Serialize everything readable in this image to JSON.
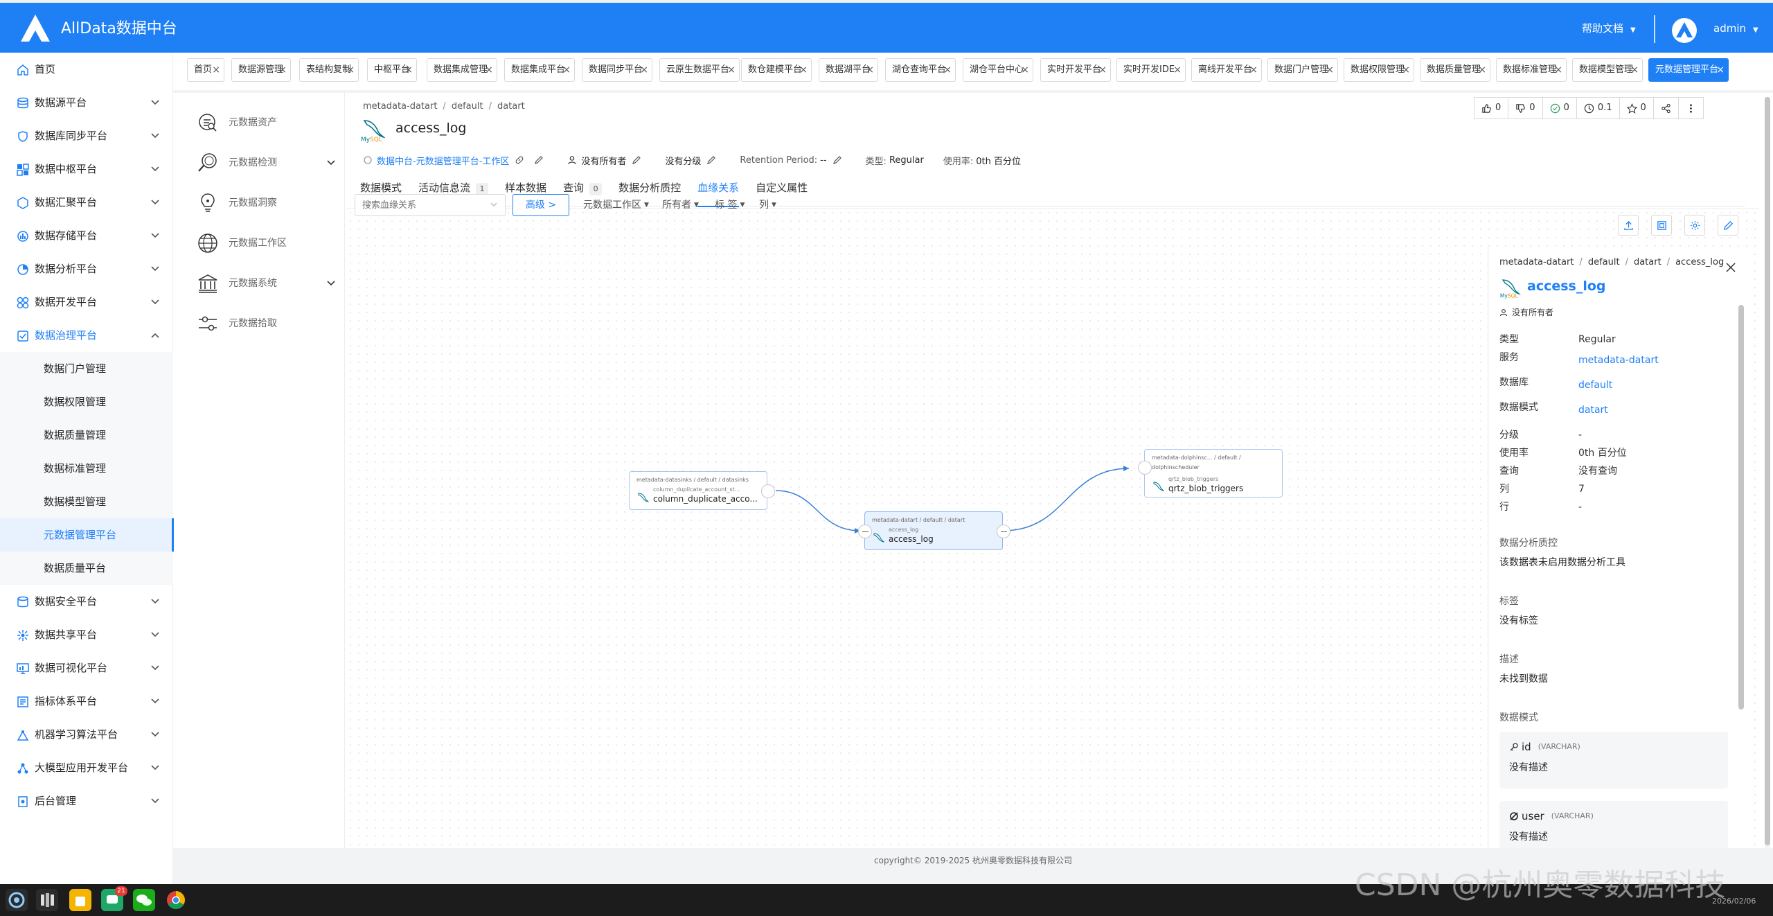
{
  "header": {
    "app_title": "AllData数据中台",
    "help": "帮助文档",
    "user": "admin",
    "brand_color": "#1f80f6"
  },
  "sidebar": {
    "items": [
      {
        "label": "首页",
        "icon": "home-icon"
      },
      {
        "label": "数据源平台",
        "icon": "database-icon"
      },
      {
        "label": "数据库同步平台",
        "icon": "sync-icon"
      },
      {
        "label": "数据中枢平台",
        "icon": "hub-icon"
      },
      {
        "label": "数据汇聚平台",
        "icon": "collect-icon"
      },
      {
        "label": "数据存储平台",
        "icon": "storage-icon"
      },
      {
        "label": "数据分析平台",
        "icon": "analysis-icon"
      },
      {
        "label": "数据开发平台",
        "icon": "develop-icon"
      },
      {
        "label": "数据治理平台",
        "icon": "governance-icon"
      }
    ],
    "sub_items": [
      {
        "label": "数据门户管理"
      },
      {
        "label": "数据权限管理"
      },
      {
        "label": "数据质量管理"
      },
      {
        "label": "数据标准管理"
      },
      {
        "label": "数据模型管理"
      },
      {
        "label": "元数据管理平台"
      },
      {
        "label": "数据质量平台"
      }
    ],
    "bottom_items": [
      {
        "label": "数据安全平台",
        "icon": "security-icon"
      },
      {
        "label": "数据共享平台",
        "icon": "share-icon"
      },
      {
        "label": "数据可视化平台",
        "icon": "visual-icon"
      },
      {
        "label": "指标体系平台",
        "icon": "metric-icon"
      },
      {
        "label": "机器学习算法平台",
        "icon": "ml-icon"
      },
      {
        "label": "大模型应用开发平台",
        "icon": "llm-icon"
      },
      {
        "label": "后台管理",
        "icon": "admin-icon"
      }
    ]
  },
  "tabs": [
    "首页",
    "数据源管理",
    "表结构复制",
    "中枢平台",
    "数据集成管理",
    "数据集成平台",
    "数据同步平台",
    "云原生数据平台",
    "数仓建模平台",
    "数据湖平台",
    "湖仓查询平台",
    "湖仓平台中心",
    "实时开发平台",
    "实时开发IDE",
    "离线开发平台",
    "数据门户管理",
    "数据权限管理",
    "数据质量管理",
    "数据标准管理",
    "数据模型管理",
    "元数据管理平台"
  ],
  "meta_nav": [
    {
      "label": "元数据资产",
      "icon": "asset-search-icon"
    },
    {
      "label": "元数据检测",
      "icon": "magnifier-icon"
    },
    {
      "label": "元数据洞察",
      "icon": "bulb-icon"
    },
    {
      "label": "元数据工作区",
      "icon": "globe-icon"
    },
    {
      "label": "元数据系统",
      "icon": "bank-icon"
    },
    {
      "label": "元数据拾取",
      "icon": "slider-icon"
    }
  ],
  "entity": {
    "breadcrumb": [
      "metadata-datart",
      "default",
      "datart"
    ],
    "name": "access_log",
    "workspace": "数据中台-元数据管理平台-工作区",
    "owner": "没有所有者",
    "tier": "没有分级",
    "retention_label": "Retention Period:",
    "retention_value": "--",
    "type_label": "类型:",
    "type_value": "Regular",
    "usage_label": "使用率:",
    "usage_value": "0th 百分位"
  },
  "actions": {
    "like": "0",
    "dislike": "0",
    "follow": "0",
    "version": "0.1",
    "star": "0"
  },
  "subtabs": [
    {
      "label": "数据模式",
      "count": ""
    },
    {
      "label": "活动信息流",
      "count": "1"
    },
    {
      "label": "样本数据",
      "count": ""
    },
    {
      "label": "查询",
      "count": "0"
    },
    {
      "label": "数据分析质控",
      "count": ""
    },
    {
      "label": "血缘关系",
      "count": ""
    },
    {
      "label": "自定义属性",
      "count": ""
    }
  ],
  "lineage": {
    "search_placeholder": "搜索血缘关系",
    "advanced": "高级",
    "filters": [
      "元数据工作区",
      "所有者",
      "标 签",
      "列"
    ],
    "nodes": [
      {
        "path": "metadata-datasinks / default / datasinks",
        "sub": "column_duplicate_account_st...",
        "name": "column_duplicate_acco..."
      },
      {
        "path": "metadata-datart / default / datart",
        "sub": "access_log",
        "name": "access_log"
      },
      {
        "path": "metadata-dolphinsc... / default /",
        "path2": "dolphinscheduler",
        "sub": "qrtz_blob_triggers",
        "name": "qrtz_blob_triggers"
      }
    ]
  },
  "panel": {
    "breadcrumb": [
      "metadata-datart",
      "default",
      "datart",
      "access_log"
    ],
    "name": "access_log",
    "owner": "没有所有者",
    "rows": [
      {
        "k": "类型",
        "v": "Regular"
      },
      {
        "k": "服务",
        "v": "metadata-datart"
      },
      {
        "k": "数据库",
        "v": "default"
      },
      {
        "k": "数据模式",
        "v": "datart"
      },
      {
        "k": "分级",
        "v": "-"
      },
      {
        "k": "使用率",
        "v": "0th 百分位"
      },
      {
        "k": "查询",
        "v": "没有查询"
      },
      {
        "k": "列",
        "v": "7"
      },
      {
        "k": "行",
        "v": "-"
      }
    ],
    "profile_title": "数据分析质控",
    "profile_text": "该数据表未启用数据分析工具",
    "tags_title": "标签",
    "tags_text": "没有标签",
    "desc_title": "描述",
    "desc_text": "未找到数据",
    "schema_title": "数据模式",
    "columns": [
      {
        "name": "id",
        "type": "(VARCHAR)",
        "desc": "没有描述"
      },
      {
        "name": "user",
        "type": "(VARCHAR)",
        "desc": "没有描述"
      }
    ]
  },
  "footer": "copyright© 2019-2025 杭州奥零数据科技有限公司",
  "taskbar": {
    "badge": "21",
    "time": "",
    "date": "2026/02/06"
  },
  "watermark": "CSDN @杭州奥零数据科技"
}
